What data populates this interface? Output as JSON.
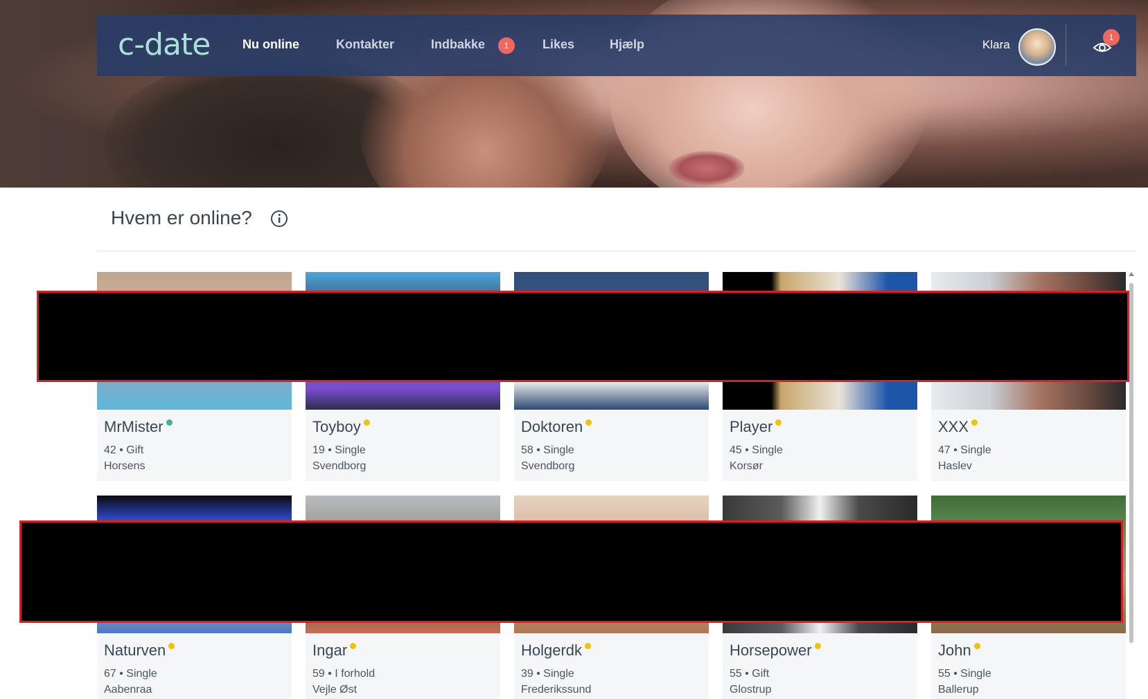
{
  "nav": {
    "logo": "c-date",
    "items": [
      {
        "label": "Nu online",
        "active": true
      },
      {
        "label": "Kontakter",
        "active": false
      },
      {
        "label": "Indbakke",
        "active": false,
        "badge": "1"
      },
      {
        "label": "Likes",
        "active": false
      },
      {
        "label": "Hjælp",
        "active": false
      }
    ],
    "user_name": "Klara",
    "visitors_badge": "1"
  },
  "page": {
    "title": "Hvem er online?"
  },
  "colors": {
    "online_dot": "#3db39e",
    "away_dot": "#f2c200",
    "badge": "#f0675e",
    "nav_bg": "#283c69"
  },
  "profiles": [
    {
      "name": "MrMister",
      "age": "42",
      "status": "Gift",
      "city": "Horsens",
      "presence": "online"
    },
    {
      "name": "Toyboy",
      "age": "19",
      "status": "Single",
      "city": "Svendborg",
      "presence": "away"
    },
    {
      "name": "Doktoren",
      "age": "58",
      "status": "Single",
      "city": "Svendborg",
      "presence": "away"
    },
    {
      "name": "Player",
      "age": "45",
      "status": "Single",
      "city": "Korsør",
      "presence": "away"
    },
    {
      "name": "XXX",
      "age": "47",
      "status": "Single",
      "city": "Haslev",
      "presence": "away"
    },
    {
      "name": "Naturven",
      "age": "67",
      "status": "Single",
      "city": "Aabenraa",
      "presence": "away"
    },
    {
      "name": "Ingar",
      "age": "59",
      "status": "I forhold",
      "city": "Vejle Øst",
      "presence": "away"
    },
    {
      "name": "Holgerdk",
      "age": "39",
      "status": "Single",
      "city": "Frederikssund",
      "presence": "away"
    },
    {
      "name": "Horsepower",
      "age": "55",
      "status": "Gift",
      "city": "Glostrup",
      "presence": "away"
    },
    {
      "name": "John",
      "age": "55",
      "status": "Single",
      "city": "Ballerup",
      "presence": "away"
    }
  ]
}
